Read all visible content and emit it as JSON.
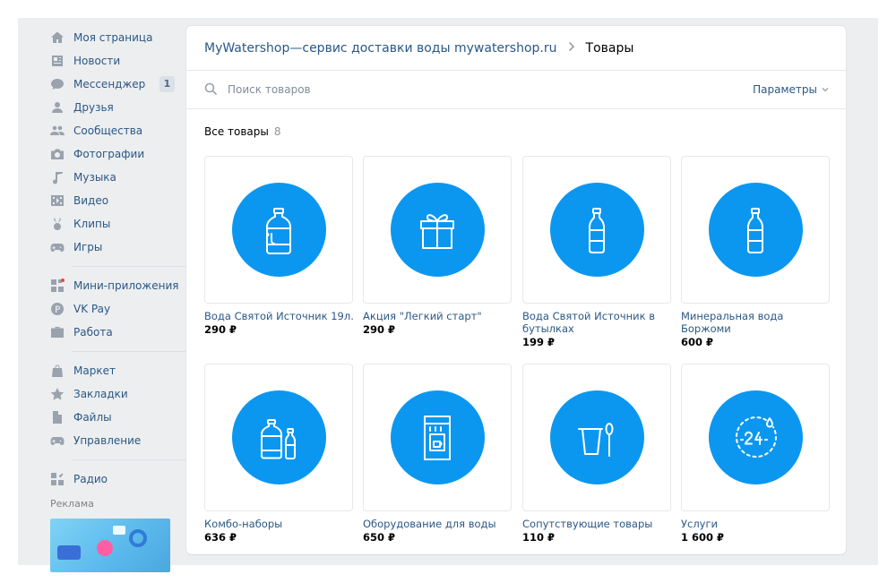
{
  "sidebar": {
    "items": [
      {
        "label": "Моя страница",
        "icon": "home-icon"
      },
      {
        "label": "Новости",
        "icon": "news-icon"
      },
      {
        "label": "Мессенджер",
        "icon": "messenger-icon",
        "badge": "1"
      },
      {
        "label": "Друзья",
        "icon": "friends-icon"
      },
      {
        "label": "Сообщества",
        "icon": "communities-icon"
      },
      {
        "label": "Фотографии",
        "icon": "camera-icon"
      },
      {
        "label": "Музыка",
        "icon": "music-icon"
      },
      {
        "label": "Видео",
        "icon": "video-icon"
      },
      {
        "label": "Клипы",
        "icon": "clips-icon"
      },
      {
        "label": "Игры",
        "icon": "gamepad-icon"
      }
    ],
    "items2": [
      {
        "label": "Мини-приложения",
        "icon": "mini-apps-icon"
      },
      {
        "label": "VK Pay",
        "icon": "vkpay-icon"
      },
      {
        "label": "Работа",
        "icon": "briefcase-icon"
      }
    ],
    "items3": [
      {
        "label": "Маркет",
        "icon": "market-bag-icon"
      },
      {
        "label": "Закладки",
        "icon": "star-icon"
      },
      {
        "label": "Файлы",
        "icon": "file-icon"
      },
      {
        "label": "Управление",
        "icon": "gamepad-icon"
      }
    ],
    "items4": [
      {
        "label": "Радио",
        "icon": "radio-icon"
      }
    ],
    "ads_label": "Реклама"
  },
  "header": {
    "shop_link": "MyWatershop—сервис доставки воды mywatershop.ru",
    "current": "Товары"
  },
  "search": {
    "placeholder": "Поиск товаров",
    "value": "",
    "params_label": "Параметры"
  },
  "section": {
    "title": "Все товары",
    "count": "8"
  },
  "products": [
    {
      "title": "Вода Святой Источник 19л.",
      "price": "290 ₽",
      "icon": "water-jug-icon"
    },
    {
      "title": "Акция \"Легкий старт\"",
      "price": "290 ₽",
      "icon": "gift-box-icon"
    },
    {
      "title": "Вода Святой Источник в бутылках",
      "price": "199 ₽",
      "icon": "water-bottle-icon"
    },
    {
      "title": "Минеральная вода Боржоми",
      "price": "600 ₽",
      "icon": "water-bottle-icon"
    },
    {
      "title": "Комбо-наборы",
      "price": "636 ₽",
      "icon": "combo-jug-bottle-icon"
    },
    {
      "title": "Оборудование для воды",
      "price": "650 ₽",
      "icon": "water-cooler-icon"
    },
    {
      "title": "Сопутствующие товары",
      "price": "110 ₽",
      "icon": "cup-spoon-icon"
    },
    {
      "title": "Услуги",
      "price": "1 600 ₽",
      "icon": "24-hours-icon"
    }
  ],
  "colors": {
    "accent": "#0b97f0",
    "link": "#2a5885",
    "background": "#edeef0",
    "icon_gray": "#99a2ad"
  }
}
